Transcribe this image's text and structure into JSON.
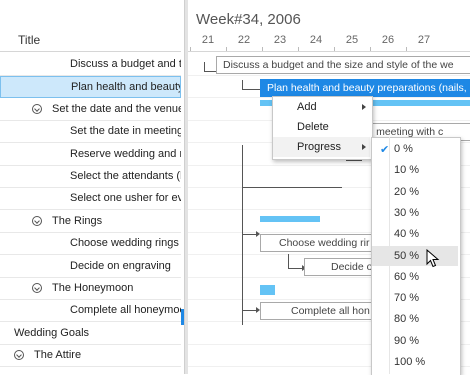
{
  "grid": {
    "header_title": "Title",
    "rows": [
      {
        "label": "Discuss a budget and th",
        "indent": 2,
        "toggle": false,
        "selected": false
      },
      {
        "label": "Plan health and beauty",
        "indent": 2,
        "toggle": false,
        "selected": true
      },
      {
        "label": "Set the date and the venue",
        "indent": 1,
        "toggle": true,
        "selected": false
      },
      {
        "label": "Set the date in meeting",
        "indent": 2,
        "toggle": false,
        "selected": false
      },
      {
        "label": "Reserve wedding and re",
        "indent": 2,
        "toggle": false,
        "selected": false
      },
      {
        "label": "Select the attendants (b",
        "indent": 2,
        "toggle": false,
        "selected": false
      },
      {
        "label": "Select one usher for eve",
        "indent": 2,
        "toggle": false,
        "selected": false
      },
      {
        "label": "The Rings",
        "indent": 1,
        "toggle": true,
        "selected": false
      },
      {
        "label": "Choose wedding rings",
        "indent": 2,
        "toggle": false,
        "selected": false
      },
      {
        "label": "Decide on engraving",
        "indent": 2,
        "toggle": false,
        "selected": false
      },
      {
        "label": "The Honeymoon",
        "indent": 1,
        "toggle": true,
        "selected": false
      },
      {
        "label": "Complete all honeymoo",
        "indent": 2,
        "toggle": false,
        "selected": false
      },
      {
        "label": "Wedding Goals",
        "indent": 0,
        "toggle": false,
        "selected": false
      },
      {
        "label": "The Attire",
        "indent": 0,
        "toggle": true,
        "selected": false
      }
    ]
  },
  "timeline": {
    "week_title": "Week#34, 2006",
    "days": [
      "21",
      "22",
      "23",
      "24",
      "25",
      "26",
      "27"
    ],
    "tasks": {
      "discuss": "Discuss a budget and the size and style of the we",
      "plan": "Plan health and beauty preparations (nails,",
      "set_date": "in meeting with c",
      "choose_rings": "Choose wedding rir",
      "decide_engraving": "Decide o",
      "complete_honeymoon": "Complete all hon"
    }
  },
  "context_menu": {
    "items": [
      {
        "label": "Add",
        "has_submenu": true
      },
      {
        "label": "Delete",
        "has_submenu": false
      },
      {
        "label": "Progress",
        "has_submenu": true
      }
    ]
  },
  "progress_menu": {
    "checked": "0 %",
    "hovered": "50 %",
    "options": [
      "0 %",
      "10 %",
      "20 %",
      "30 %",
      "40 %",
      "50 %",
      "60 %",
      "70 %",
      "80 %",
      "90 %",
      "100 %"
    ]
  },
  "colors": {
    "accent": "#1e88e5",
    "summary_bar": "#64c3f5",
    "selected_row": "#cde8fb"
  }
}
